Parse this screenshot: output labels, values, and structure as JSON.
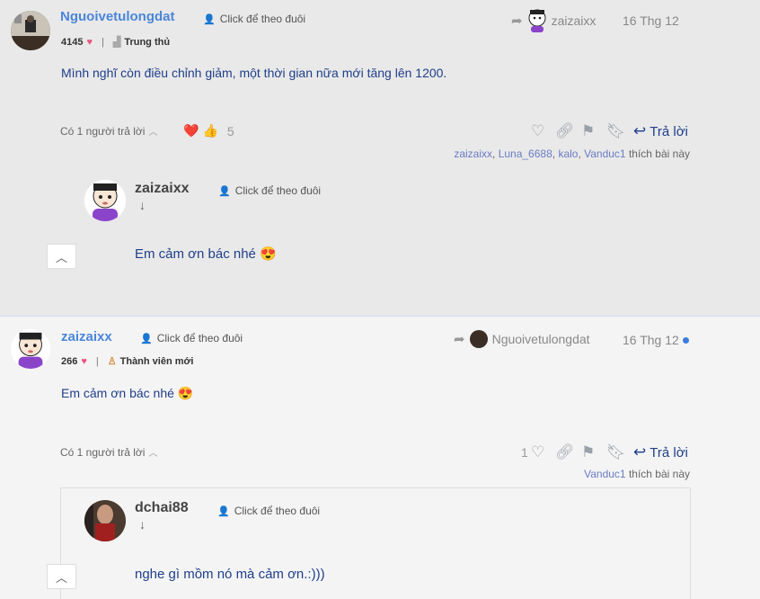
{
  "post1": {
    "username": "Nguoivetulongdat",
    "follow_label": "Click để theo đuôi",
    "points": "4145",
    "rank": "Trung thủ",
    "quote_to": "zaizaixx",
    "date": "16 Thg 12",
    "content": "Mình nghĩ còn điều chỉnh giảm, một thời gian nữa mới tăng lên 1200.",
    "replies_label": "Có 1 người trả lời",
    "reaction_icons": [
      "heart-emoji",
      "thumbs-up-emoji"
    ],
    "reaction_count": "5",
    "reply_button": "Trả lời",
    "likers": [
      "zaizaixx",
      "Luna_6688",
      "kalo",
      "Vanduc1"
    ],
    "likes_suffix": "thích bài này",
    "nested": {
      "username": "zaizaixx",
      "follow_label": "Click để theo đuôi",
      "content": "Em cảm ơn bác nhé 😍"
    }
  },
  "post2": {
    "username": "zaizaixx",
    "follow_label": "Click để theo đuôi",
    "points": "266",
    "rank": "Thành viên mới",
    "quote_to": "Nguoivetulongdat",
    "date": "16 Thg 12",
    "content": "Em cảm ơn bác nhé 😍",
    "replies_label": "Có 1 người trả lời",
    "like_count": "1",
    "reply_button": "Trả lời",
    "likers": [
      "Vanduc1"
    ],
    "likes_suffix": "thích bài này",
    "nested": {
      "username": "dchai88",
      "follow_label": "Click để theo đuôi",
      "content": "nghe gì mồm nó mà cảm ơn.:)))"
    }
  },
  "colors": {
    "username": "#4a86d9",
    "content": "#1f3f8a",
    "heart": "#e9557e",
    "unread_dot": "#3b7ddd"
  }
}
